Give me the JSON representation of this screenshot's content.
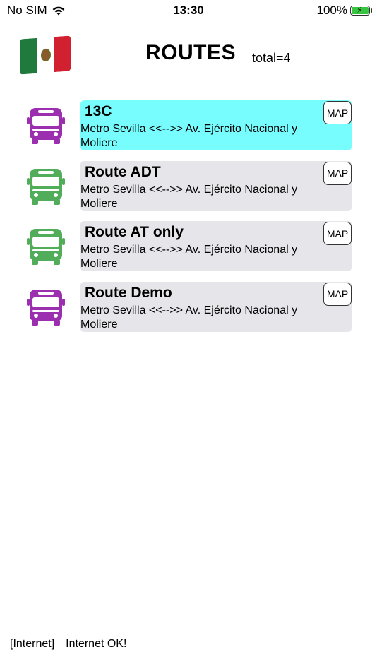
{
  "status_bar": {
    "carrier": "No SIM",
    "time": "13:30",
    "battery": "100%",
    "icons": [
      "wifi-icon",
      "battery-charging-icon"
    ]
  },
  "header": {
    "title": "ROUTES",
    "total": "total=4",
    "flag_icon": "mexico-flag-icon"
  },
  "routes": [
    {
      "name": "13C",
      "description": " Metro Sevilla <<-->> Av. Ejército Nacional y Moliere",
      "map_label": "MAP",
      "bus_color": "#9b2fb0",
      "selected": true
    },
    {
      "name": "Route ADT",
      "description": " Metro Sevilla <<-->> Av. Ejército Nacional y Moliere",
      "map_label": "MAP",
      "bus_color": "#52ad5a",
      "selected": false
    },
    {
      "name": "Route AT only",
      "description": " Metro Sevilla <<-->> Av. Ejército Nacional y Moliere",
      "map_label": "MAP",
      "bus_color": "#52ad5a",
      "selected": false
    },
    {
      "name": "Route Demo",
      "description": " Metro Sevilla <<-->> Av. Ejército Nacional y Moliere",
      "map_label": "MAP",
      "bus_color": "#9b2fb0",
      "selected": false
    }
  ],
  "footer": {
    "tag": "[Internet]",
    "message": "Internet OK!"
  },
  "colors": {
    "selected_row": "#78fdfe",
    "row_bg": "#e5e5ea"
  }
}
